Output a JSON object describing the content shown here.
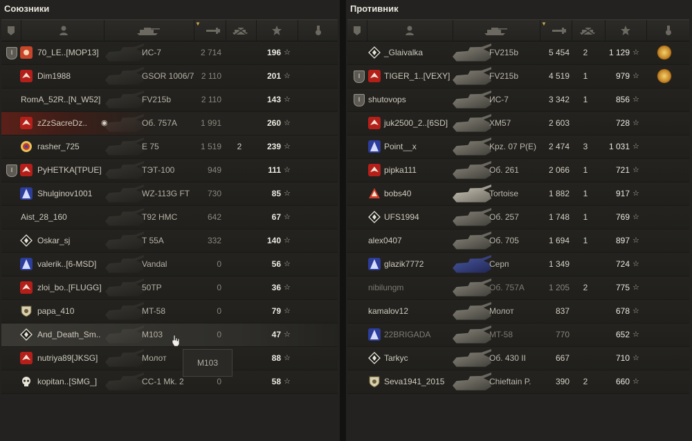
{
  "allies": {
    "title": "Союзники",
    "rows": [
      {
        "badge": "I",
        "clan": "orange",
        "name": "70_LE..[MOP13]",
        "tank": "ИС-7",
        "dmg": "2 714",
        "kills": "",
        "exp": "196",
        "dim": false
      },
      {
        "badge": "",
        "clan": "red",
        "name": "Dim1988",
        "tank": "GSOR 1006/7",
        "dmg": "2 110",
        "kills": "",
        "exp": "201",
        "dim": false
      },
      {
        "badge": "",
        "clan": "",
        "name": "RomA_52R..[N_W52]",
        "tank": "FV215b",
        "dmg": "2 110",
        "kills": "",
        "exp": "143",
        "dim": false
      },
      {
        "badge": "",
        "clan": "red",
        "name": "zZzSacreDz..",
        "tank": "Об. 757А",
        "dmg": "1 991",
        "kills": "",
        "exp": "260",
        "dim": false,
        "me": true
      },
      {
        "badge": "",
        "clan": "target",
        "name": "rasher_725",
        "tank": "E 75",
        "dmg": "1 519",
        "kills": "2",
        "exp": "239",
        "dim": false
      },
      {
        "badge": "I",
        "clan": "red",
        "name": "PyHETKA[TPUE]",
        "tank": "ТЭТ-100",
        "dmg": "949",
        "kills": "",
        "exp": "111",
        "dim": false
      },
      {
        "badge": "",
        "clan": "blue",
        "name": "Shulginov1001",
        "tank": "WZ-113G FT",
        "dmg": "730",
        "kills": "",
        "exp": "85",
        "dim": false
      },
      {
        "badge": "",
        "clan": "",
        "name": "Aist_28_160",
        "tank": "T92 HMC",
        "dmg": "642",
        "kills": "",
        "exp": "67",
        "dim": false
      },
      {
        "badge": "",
        "clan": "diamond",
        "name": "Oskar_sj",
        "tank": "T 55A",
        "dmg": "332",
        "kills": "",
        "exp": "140",
        "dim": false
      },
      {
        "badge": "",
        "clan": "blue",
        "name": "valerik..[6-MSD]",
        "tank": "Vandal",
        "dmg": "0",
        "kills": "",
        "exp": "56",
        "dim": false
      },
      {
        "badge": "",
        "clan": "red",
        "name": "zloi_bo..[FLUGG]",
        "tank": "50TP",
        "dmg": "0",
        "kills": "",
        "exp": "36",
        "dim": false
      },
      {
        "badge": "",
        "clan": "shield",
        "name": "papa_410",
        "tank": "MT-58",
        "dmg": "0",
        "kills": "",
        "exp": "79",
        "dim": false
      },
      {
        "badge": "",
        "clan": "diamond",
        "name": "And_Death_Sm..",
        "tank": "M103",
        "dmg": "0",
        "kills": "",
        "exp": "47",
        "dim": false,
        "hl": true
      },
      {
        "badge": "",
        "clan": "red",
        "name": "nutriya89[JKSG]",
        "tank": "Молот",
        "dmg": "0",
        "kills": "",
        "exp": "88",
        "dim": false
      },
      {
        "badge": "",
        "clan": "skull",
        "name": "kopitan..[SMG_]",
        "tank": "CC-1 Mk. 2",
        "dmg": "0",
        "kills": "",
        "exp": "58",
        "dim": false
      }
    ]
  },
  "enemies": {
    "title": "Противник",
    "rows": [
      {
        "badge": "",
        "clan": "diamond",
        "name": "_Glaivalka",
        "tank": "FV215b",
        "dmg": "5 454",
        "kills": "2",
        "exp": "1 129",
        "medal": true
      },
      {
        "badge": "I",
        "clan": "red",
        "name": "TIGER_1..[VEXY]",
        "tank": "FV215b",
        "dmg": "4 519",
        "kills": "1",
        "exp": "979",
        "medal": true
      },
      {
        "badge": "I",
        "clan": "",
        "name": "shutovops",
        "tank": "ИС-7",
        "dmg": "3 342",
        "kills": "1",
        "exp": "856"
      },
      {
        "badge": "",
        "clan": "red",
        "name": "juk2500_2..[6SD]",
        "tank": "XM57",
        "dmg": "2 603",
        "kills": "",
        "exp": "728"
      },
      {
        "badge": "",
        "clan": "blue",
        "name": "Point__x",
        "tank": "Kpz. 07 P(E)",
        "dmg": "2 474",
        "kills": "3",
        "exp": "1 031"
      },
      {
        "badge": "",
        "clan": "red",
        "name": "pipka111",
        "tank": "Об. 261",
        "dmg": "2 066",
        "kills": "1",
        "exp": "721"
      },
      {
        "badge": "",
        "clan": "warn",
        "name": "bobs40",
        "tank": "Tortoise",
        "dmg": "1 882",
        "kills": "1",
        "exp": "917"
      },
      {
        "badge": "",
        "clan": "diamond",
        "name": "UFS1994",
        "tank": "Об. 257",
        "dmg": "1 748",
        "kills": "1",
        "exp": "769"
      },
      {
        "badge": "",
        "clan": "",
        "name": "alex0407",
        "tank": "Об. 705",
        "dmg": "1 694",
        "kills": "1",
        "exp": "897"
      },
      {
        "badge": "",
        "clan": "blue",
        "name": "glazik7772",
        "tank": "Серп",
        "dmg": "1 349",
        "kills": "",
        "exp": "724"
      },
      {
        "badge": "",
        "clan": "",
        "name": "nibilungm",
        "tank": "Об. 757А",
        "dmg": "1 205",
        "kills": "2",
        "exp": "775",
        "dead": true
      },
      {
        "badge": "",
        "clan": "",
        "name": "kamalov12",
        "tank": "Молот",
        "dmg": "837",
        "kills": "",
        "exp": "678"
      },
      {
        "badge": "",
        "clan": "blue",
        "name": "22BRIGADA",
        "tank": "MT-58",
        "dmg": "770",
        "kills": "",
        "exp": "652",
        "dead": true
      },
      {
        "badge": "",
        "clan": "diamond",
        "name": "Tarkyc",
        "tank": "Об. 430 II",
        "dmg": "667",
        "kills": "",
        "exp": "710"
      },
      {
        "badge": "",
        "clan": "shield",
        "name": "Seva1941_2015",
        "tank": "Chieftain P.",
        "dmg": "390",
        "kills": "2",
        "exp": "660"
      }
    ]
  },
  "tooltip": {
    "text": "M103"
  },
  "colors": {
    "red": "#b51f1a",
    "blue": "#2c3d9a",
    "orange": "#c7452a",
    "gold": "#d1a93b"
  }
}
